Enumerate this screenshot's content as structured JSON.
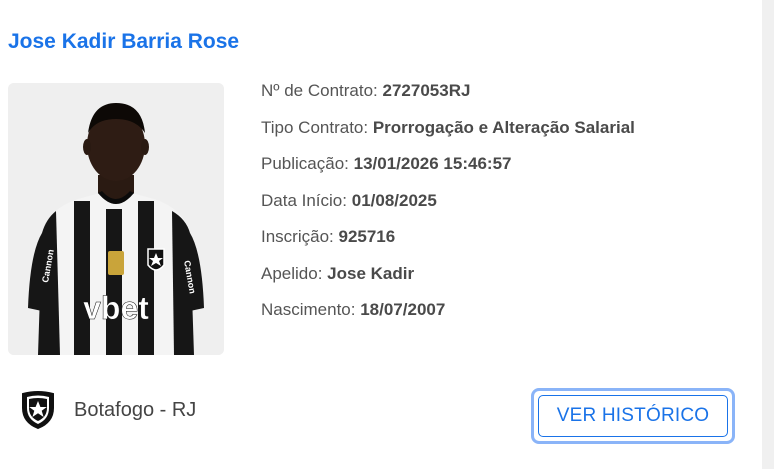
{
  "player": {
    "name": "Jose Kadir Barria Rose"
  },
  "details": [
    {
      "label": "Nº de Contrato:",
      "value": "2727053RJ"
    },
    {
      "label": "Tipo Contrato:",
      "value": "Prorrogação e Alteração Salarial"
    },
    {
      "label": "Publicação:",
      "value": "13/01/2026 15:46:57"
    },
    {
      "label": "Data Início:",
      "value": "01/08/2025"
    },
    {
      "label": "Inscrição:",
      "value": "925716"
    },
    {
      "label": "Apelido:",
      "value": "Jose Kadir"
    },
    {
      "label": "Nascimento:",
      "value": "18/07/2007"
    }
  ],
  "club": {
    "name": "Botafogo - RJ",
    "crest_icon": "botafogo-crest-icon"
  },
  "actions": {
    "history_label": "VER HISTÓRICO"
  },
  "photo": {
    "shirt_text": "vbet",
    "sponsor_side_text": "Cannon"
  },
  "colors": {
    "accent": "#1a73e8",
    "button_focus_ring": "#8ab4f8"
  }
}
